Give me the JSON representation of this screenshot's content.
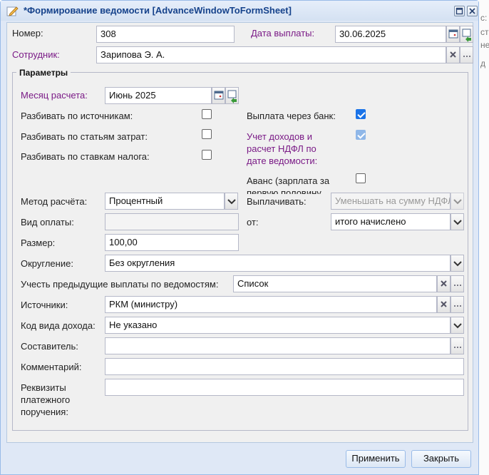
{
  "window": {
    "title": "*Формирование ведомости [AdvanceWindowToFormSheet]"
  },
  "header": {
    "number_label": "Номер:",
    "number_value": "308",
    "pay_date_label": "Дата выплаты:",
    "pay_date_value": "30.06.2025",
    "employee_label": "Сотрудник:",
    "employee_value": "Зарипова Э. А."
  },
  "params": {
    "legend": "Параметры",
    "month_label": "Месяц расчета:",
    "month_value": "Июнь 2025",
    "split_sources_label": "Разбивать по источникам:",
    "split_sources_checked": false,
    "split_costs_label": "Разбивать по статьям затрат:",
    "split_costs_checked": false,
    "split_tax_label": "Разбивать по ставкам налога:",
    "split_tax_checked": false,
    "bank_label": "Выплата через банк:",
    "bank_checked": true,
    "ndfl_label_1": "Учет доходов и",
    "ndfl_label_2": "расчет НДФЛ по",
    "ndfl_label_3": "дате ведомости:",
    "ndfl_checked": true,
    "advance_label_1": "Аванс (зарплата за",
    "advance_label_2": "первую половину",
    "advance_checked": false,
    "method_label": "Метод расчёта:",
    "method_value": "Процентный",
    "pay_out_label": "Выплачивать:",
    "pay_out_value": "Уменьшать на сумму НДФЛ",
    "pay_type_label": "Вид оплаты:",
    "pay_type_value": "",
    "from_label": "от:",
    "from_value": "итого начислено",
    "size_label": "Размер:",
    "size_value": "100,00",
    "rounding_label": "Округление:",
    "rounding_value": "Без округления",
    "prev_label": "Учесть предыдущие выплаты по ведомостям:",
    "prev_value": "Список",
    "sources_label": "Источники:",
    "sources_value": "РКМ (министру)",
    "income_code_label": "Код вида дохода:",
    "income_code_value": "Не указано",
    "author_label": "Составитель:",
    "author_value": "",
    "comment_label": "Комментарий:",
    "comment_value": "",
    "requisites_label_1": "Реквизиты",
    "requisites_label_2": "платежного",
    "requisites_label_3": "поручения:",
    "requisites_value": ""
  },
  "footer": {
    "apply_label": "Применить",
    "close_label": "Закрыть"
  },
  "background": {
    "frag_1": "с:",
    "frag_2": "ст",
    "frag_3": "не",
    "frag_4": "д"
  },
  "colors": {
    "required_label": "#7a1a86",
    "title_text": "#15428b",
    "window_bg": "#dfe8f6",
    "checkbox_checked": "#1a73e8"
  },
  "icons": {
    "calendar": "calendar-icon",
    "clear": "clear-x-icon",
    "ellipsis": "ellipsis-icon",
    "dropdown": "chevron-down-icon"
  }
}
